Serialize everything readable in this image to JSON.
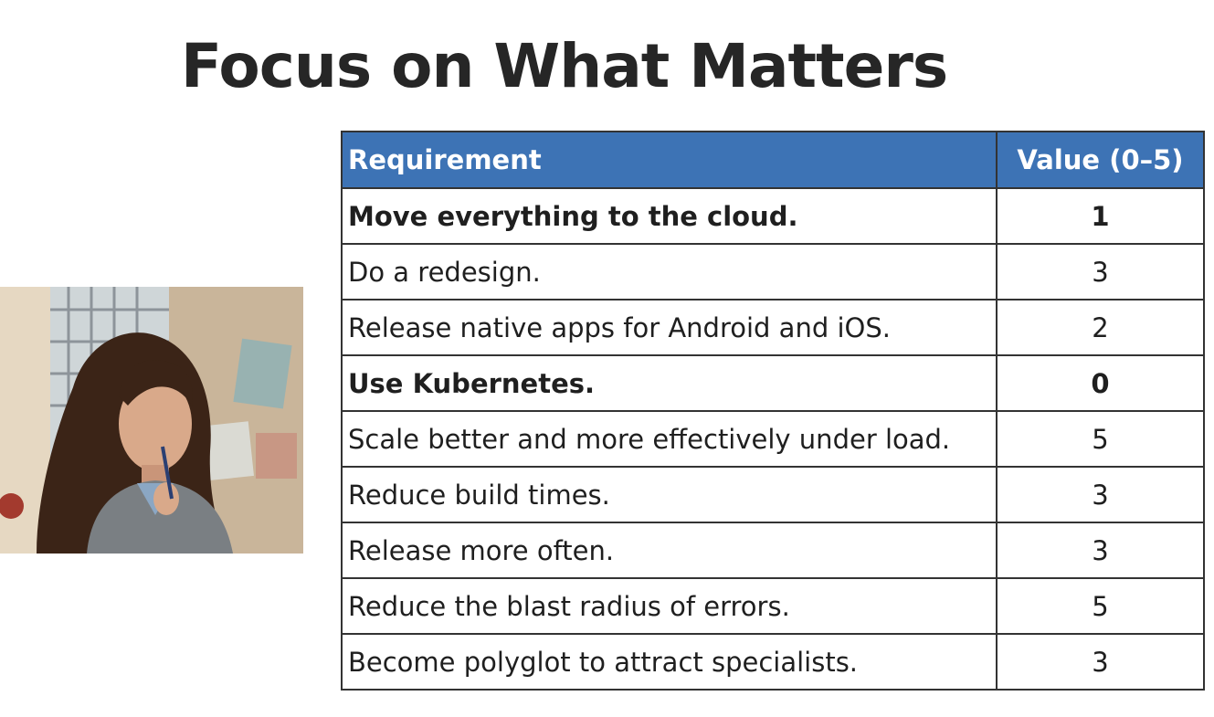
{
  "slide": {
    "title": "Focus on What Matters"
  },
  "table": {
    "headers": {
      "requirement": "Requirement",
      "value": "Value (0–5)"
    },
    "rows": [
      {
        "requirement": "Move everything to the cloud.",
        "value": "1",
        "bold": true
      },
      {
        "requirement": "Do a redesign.",
        "value": "3",
        "bold": false
      },
      {
        "requirement": "Release native apps for Android and iOS.",
        "value": "2",
        "bold": false
      },
      {
        "requirement": "Use Kubernetes.",
        "value": "0",
        "bold": true
      },
      {
        "requirement": "Scale better and more effectively under load.",
        "value": "5",
        "bold": false
      },
      {
        "requirement": "Reduce build times.",
        "value": "3",
        "bold": false
      },
      {
        "requirement": "Release more often.",
        "value": "3",
        "bold": false
      },
      {
        "requirement": "Reduce the blast radius of errors.",
        "value": "5",
        "bold": false
      },
      {
        "requirement": "Become polyglot to attract specialists.",
        "value": "3",
        "bold": false
      }
    ]
  },
  "colors": {
    "header_bg": "#3d73b5",
    "header_text": "#ffffff",
    "border": "#333333",
    "title": "#262626"
  }
}
